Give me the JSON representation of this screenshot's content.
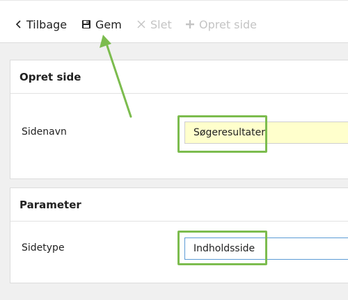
{
  "toolbar": {
    "back_label": "Tilbage",
    "save_label": "Gem",
    "delete_label": "Slet",
    "create_label": "Opret side"
  },
  "panel_create": {
    "title": "Opret side",
    "field_label": "Sidenavn",
    "field_value": "Søgeresultater"
  },
  "panel_parameter": {
    "title": "Parameter",
    "field_label": "Sidetype",
    "field_value": "Indholdsside"
  },
  "colors": {
    "highlight": "#7cbc4e",
    "input_yellow": "#ffffcc",
    "focus_border": "#5b9bd5",
    "disabled_text": "#c4c4c4"
  },
  "icons": [
    "chevron-left-icon",
    "floppy-disk-icon",
    "close-icon",
    "plus-icon"
  ]
}
